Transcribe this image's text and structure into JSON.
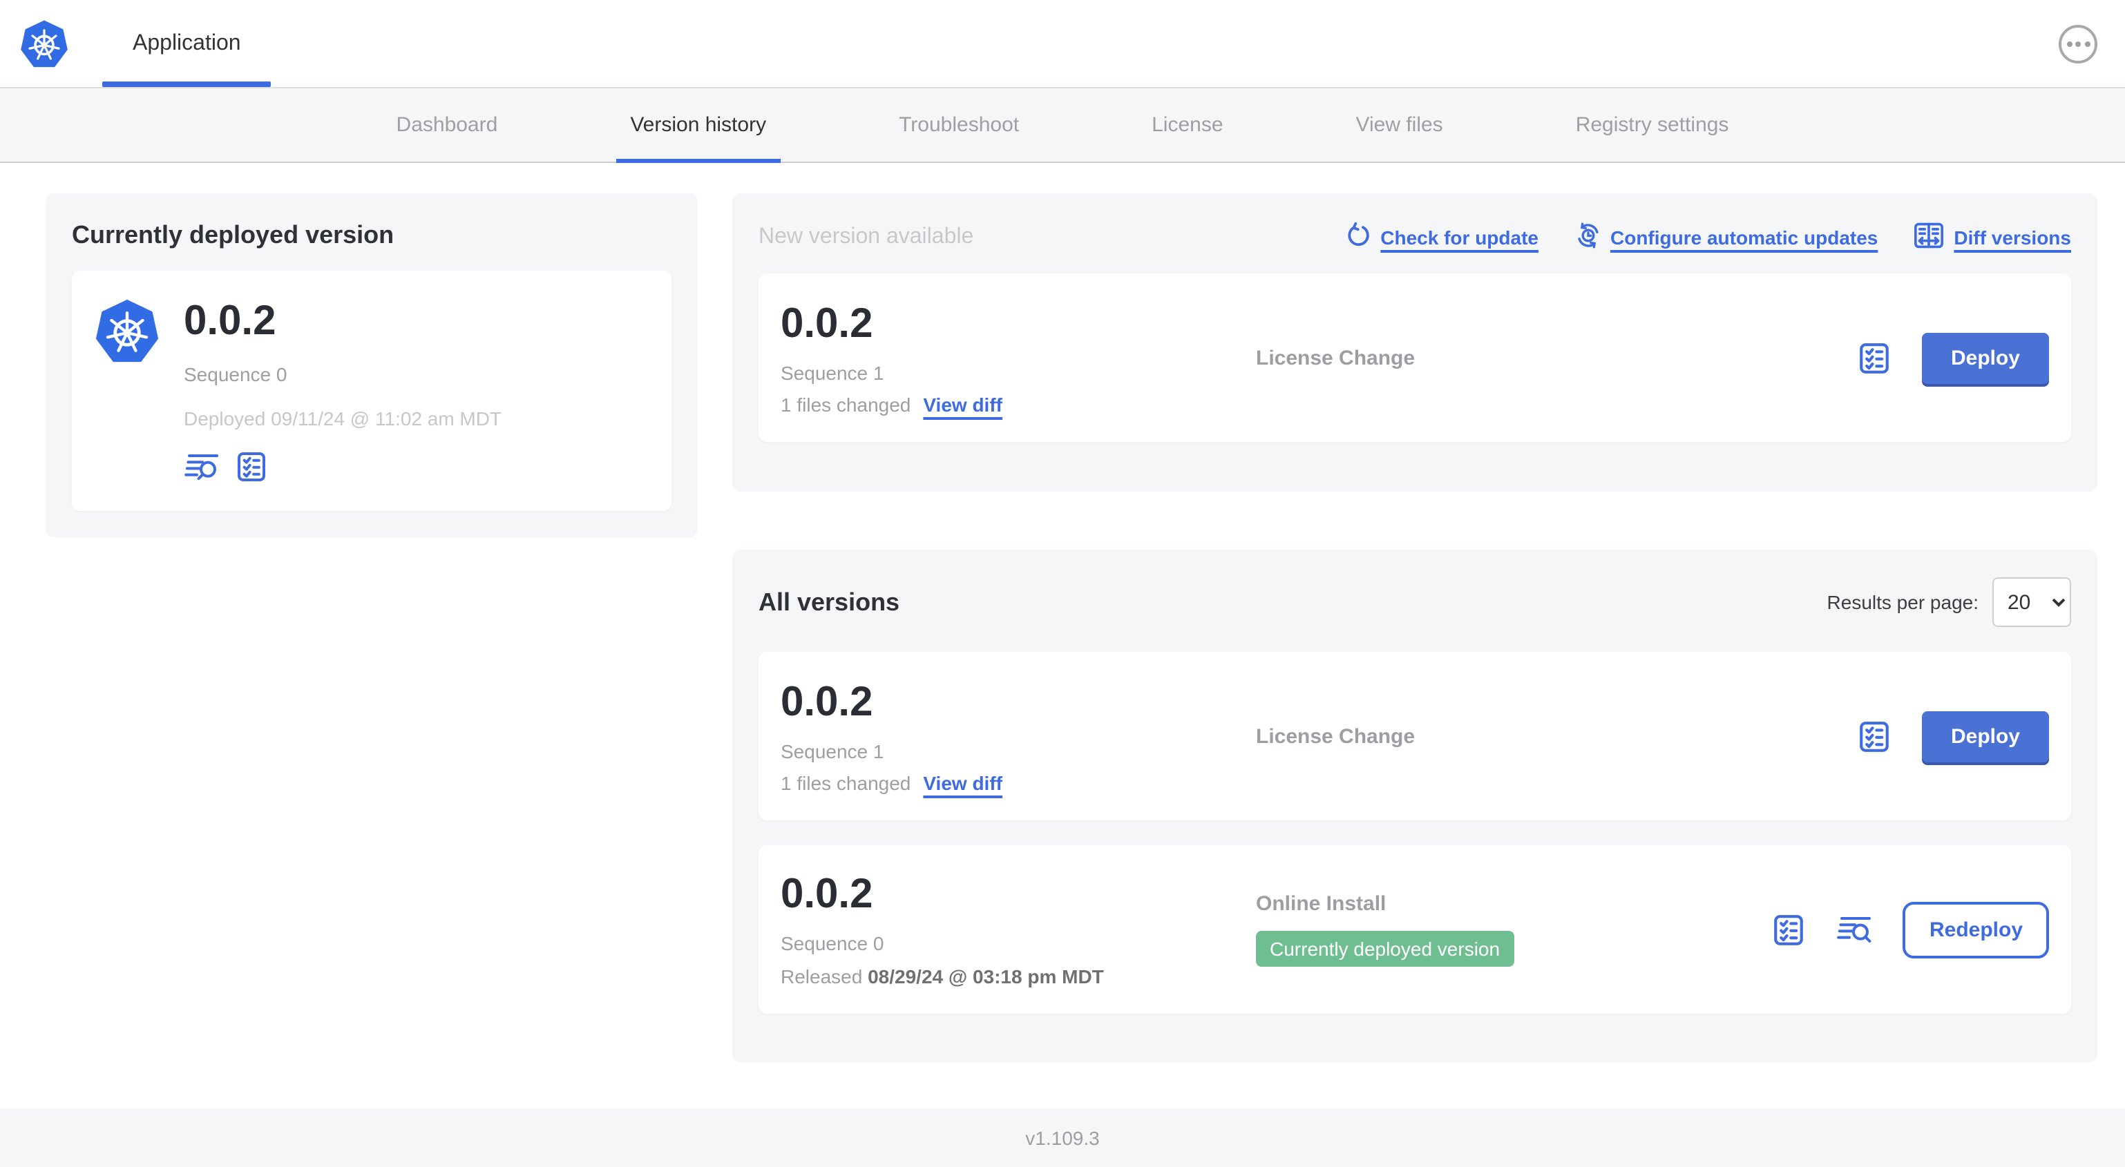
{
  "app": {
    "tab_label": "Application"
  },
  "nav": {
    "tabs": [
      "Dashboard",
      "Version history",
      "Troubleshoot",
      "License",
      "View files",
      "Registry settings"
    ],
    "active_tab": "Version history"
  },
  "current_version_panel": {
    "title": "Currently deployed version",
    "version": "0.0.2",
    "sequence": "Sequence 0",
    "deployed_at": "Deployed 09/11/24 @ 11:02 am MDT"
  },
  "new_version_panel": {
    "title": "New version available",
    "check_for_update_label": "Check for update",
    "configure_updates_label": "Configure automatic updates",
    "diff_versions_label": "Diff versions",
    "card": {
      "version": "0.0.2",
      "sequence": "Sequence 1",
      "files_changed": "1 files changed",
      "view_diff_label": "View diff",
      "source": "License Change",
      "action_label": "Deploy"
    }
  },
  "all_versions_panel": {
    "title": "All versions",
    "results_per_page_label": "Results per page:",
    "results_per_page_value": "20",
    "rows": [
      {
        "version": "0.0.2",
        "sequence": "Sequence 1",
        "files_changed": "1 files changed",
        "view_diff_label": "View diff",
        "source": "License Change",
        "action_label": "Deploy"
      },
      {
        "version": "0.0.2",
        "sequence": "Sequence 0",
        "released_prefix": "Released ",
        "released_date": "08/29/24 @ 03:18 pm MDT",
        "source": "Online Install",
        "badge": "Currently deployed version",
        "action_label": "Redeploy"
      }
    ]
  },
  "footer": {
    "app_version": "v1.109.3"
  },
  "colors": {
    "accent_blue": "#3E6BDF",
    "button_blue": "#4A72D4",
    "k8s_blue": "#326CE5",
    "badge_green": "#6FBE91"
  }
}
